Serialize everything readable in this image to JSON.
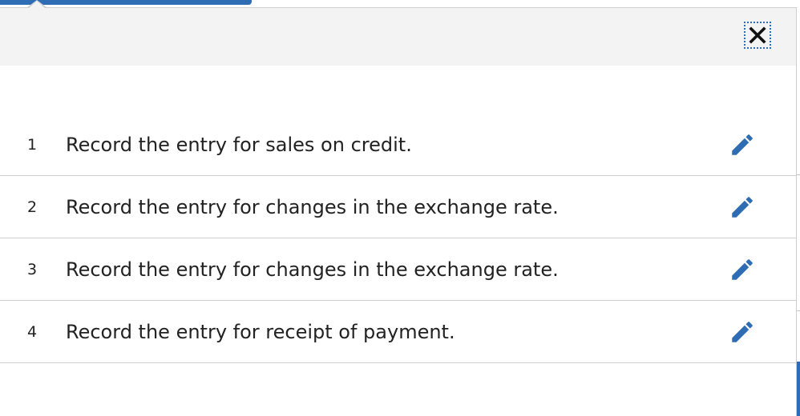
{
  "popup": {
    "close_icon": "close-x-icon",
    "tasks": [
      {
        "number": "1",
        "text": "Record the entry for sales on credit.",
        "icon": "pencil-edit-icon"
      },
      {
        "number": "2",
        "text": "Record the entry for changes in the exchange rate.",
        "icon": "pencil-edit-icon"
      },
      {
        "number": "3",
        "text": "Record the entry for changes in the exchange rate.",
        "icon": "pencil-edit-icon"
      },
      {
        "number": "4",
        "text": "Record the entry for receipt of payment.",
        "icon": "pencil-edit-icon"
      }
    ]
  },
  "colors": {
    "accent": "#2e6db4",
    "header_bg": "#f3f3f3",
    "divider": "#cfcfcf",
    "text": "#222222"
  }
}
